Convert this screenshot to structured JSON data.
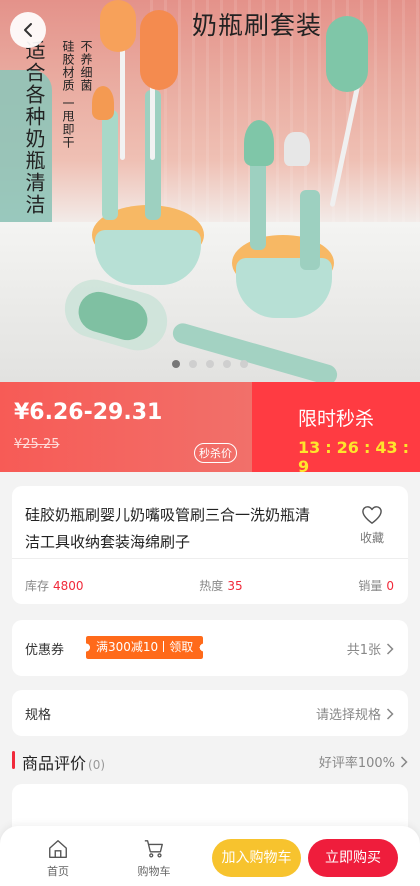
{
  "hero": {
    "title_fragment": "奶瓶刷套装",
    "vertical_text": "适合各种奶瓶清洁",
    "vertical_sub1": "硅胶材质 一甩即干",
    "vertical_sub2": "不养细菌",
    "carousel": {
      "total": 5,
      "active": 0
    }
  },
  "price": {
    "range": "¥6.26-29.31",
    "original": "¥25.25",
    "tag": "秒杀价",
    "flash_title": "限时秒杀",
    "countdown": {
      "h": "13",
      "m": "26",
      "s": "43",
      "ms": "9",
      "sep": ":"
    }
  },
  "product": {
    "title": "硅胶奶瓶刷婴儿奶嘴吸管刷三合一洗奶瓶清洁工具收纳套装海绵刷子",
    "favorite_label": "收藏",
    "stats": [
      {
        "label": "库存",
        "value": "4800"
      },
      {
        "label": "热度",
        "value": "35"
      },
      {
        "label": "销量",
        "value": "0"
      }
    ]
  },
  "coupon": {
    "label": "优惠券",
    "ticket_text": "满300减10",
    "ticket_action": "领取",
    "count": "共1张"
  },
  "spec": {
    "label": "规格",
    "placeholder": "请选择规格"
  },
  "reviews": {
    "title": "商品评价",
    "count": "(0)",
    "rate": "好评率100%"
  },
  "bottom_nav": {
    "home": "首页",
    "cart": "购物车",
    "add_to_cart": "加入购物车",
    "buy_now": "立即购买"
  },
  "colors": {
    "accent_red": "#f12a3a",
    "price_bg": "#f75b56",
    "flash_bg": "#ff3b42",
    "countdown": "#ffe42c",
    "coupon": "#ff6a1a",
    "cart_btn": "#f7c32e",
    "buy_btn": "#ef1d3c"
  },
  "icons": [
    "back-arrow-icon",
    "heart-outline-icon",
    "chevron-right-icon",
    "home-icon",
    "cart-icon"
  ]
}
